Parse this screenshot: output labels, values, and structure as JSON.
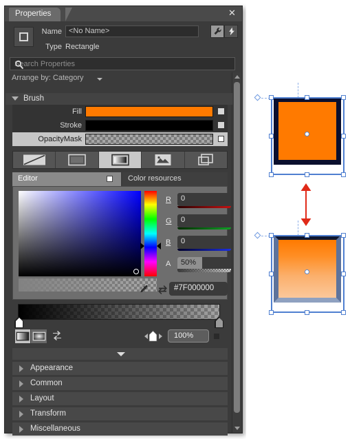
{
  "panel": {
    "tab_title": "Properties",
    "close_icon": "close-icon",
    "element_type_icon": "rectangle-icon",
    "name_label": "Name",
    "name_value": "<No Name>",
    "type_label": "Type",
    "type_value": "Rectangle",
    "wrench_icon": "wrench-icon",
    "event_icon": "lightning-bolt-icon",
    "search_placeholder": "Search Properties",
    "search_icon": "search-icon",
    "arrange_by": "Arrange by: Category"
  },
  "brush": {
    "section_title": "Brush",
    "rows": [
      {
        "label": "Fill",
        "swatch_type": "solid",
        "color": "#FF7A00",
        "selected": false,
        "advanced_icon": "advanced-options-icon"
      },
      {
        "label": "Stroke",
        "swatch_type": "solid",
        "color": "#000000",
        "selected": false,
        "advanced_icon": "advanced-options-icon"
      },
      {
        "label": "OpacityMask",
        "swatch_type": "gradient-alpha",
        "color": "#7F000000",
        "selected": true,
        "advanced_icon": "advanced-options-icon"
      }
    ],
    "brush_types": [
      {
        "name": "no-brush",
        "icon": "no-brush-icon",
        "selected": false
      },
      {
        "name": "solid-color-brush",
        "icon": "solid-color-icon",
        "selected": false
      },
      {
        "name": "gradient-brush",
        "icon": "gradient-icon",
        "selected": true
      },
      {
        "name": "tile-brush",
        "icon": "image-brush-icon",
        "selected": false
      },
      {
        "name": "visual-brush",
        "icon": "visual-brush-icon",
        "selected": false
      }
    ],
    "tabs": [
      {
        "label": "Editor",
        "active": true,
        "pin_icon": "pin-icon"
      },
      {
        "label": "Color resources",
        "active": false
      }
    ],
    "channels": [
      {
        "key": "R",
        "value": "0",
        "bar_color": "#c41111"
      },
      {
        "key": "G",
        "value": "0",
        "bar_color": "#0fa024"
      },
      {
        "key": "B",
        "value": "0",
        "bar_color": "#1c2fe0"
      },
      {
        "key": "A",
        "value": "50%",
        "bar_color": "#d8d8d8"
      }
    ],
    "hex_value": "#7F000000",
    "eyedropper_icon": "eyedropper-icon",
    "swap_icon": "swap-colors-icon",
    "gradient_stops": [
      {
        "position_pct": 0,
        "color": "#000000",
        "selected": true
      },
      {
        "position_pct": 100,
        "color": "#9b9b9b",
        "selected": false
      }
    ],
    "gradient_tools": [
      {
        "name": "linear-gradient",
        "icon": "linear-gradient-icon",
        "selected": true
      },
      {
        "name": "radial-gradient",
        "icon": "radial-gradient-icon",
        "selected": false
      }
    ],
    "reverse_icon": "reverse-gradient-stops-icon",
    "offset_prev_icon": "previous-stop-icon",
    "offset_next_icon": "next-stop-icon",
    "offset_marker_icon": "gradient-stop-marker-icon",
    "offset_value": "100%",
    "offset_advanced_icon": "advanced-options-icon",
    "collapse_icon": "chevron-down-icon"
  },
  "categories": [
    {
      "label": "Appearance",
      "expander_icon": "chevron-right-icon"
    },
    {
      "label": "Common",
      "expander_icon": "chevron-right-icon"
    },
    {
      "label": "Layout",
      "expander_icon": "chevron-right-icon"
    },
    {
      "label": "Transform",
      "expander_icon": "chevron-right-icon"
    },
    {
      "label": "Miscellaneous",
      "expander_icon": "chevron-right-icon"
    }
  ],
  "scrollbar": {
    "up_icon": "scroll-up-icon",
    "down_icon": "scroll-down-icon"
  },
  "canvas": {
    "shapes": [
      {
        "name": "rectangle-without-opacity-mask",
        "fill": "#FF7A00",
        "stroke": "#0a0f2e",
        "origin_icon": "transform-origin-icon",
        "center_icon": "center-point-icon"
      },
      {
        "name": "rectangle-with-opacity-mask",
        "fill_top": "#FF7A00",
        "fill_bottom": "#FBC291",
        "stroke": "#6c84ad",
        "origin_icon": "transform-origin-icon",
        "center_icon": "center-point-icon"
      }
    ],
    "annotation": {
      "name": "comparison-arrow",
      "icon": "double-headed-arrow-icon",
      "color": "#e02a18"
    }
  }
}
